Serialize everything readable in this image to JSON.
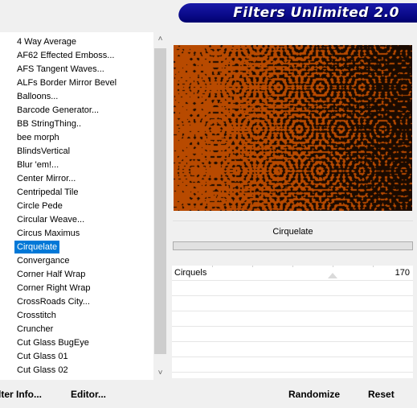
{
  "header": {
    "title": "Filters Unlimited 2.0"
  },
  "filter_list": {
    "items": [
      "4 Way Average",
      "AF62 Effected Emboss...",
      "AFS Tangent Waves...",
      "ALFs Border Mirror Bevel",
      "Balloons...",
      "Barcode Generator...",
      "BB StringThing..",
      "bee morph",
      "BlindsVertical",
      "Blur 'em!...",
      "Center Mirror...",
      "Centripedal Tile",
      "Circle Pede",
      "Circular Weave...",
      "Circus Maximus",
      "Cirquelate",
      "Convergance",
      "Corner Half Wrap",
      "Corner Right Wrap",
      "CrossRoads City...",
      "Crosstitch",
      "Cruncher",
      "Cut Glass  BugEye",
      "Cut Glass 01",
      "Cut Glass 02"
    ],
    "selected": "Cirquelate"
  },
  "scrollbar": {
    "up_glyph": "˄",
    "down_glyph": "˅"
  },
  "preview": {
    "base_color": "#b84a00",
    "dot_color": "#1a0a00"
  },
  "filter_panel": {
    "name": "Cirquelate"
  },
  "parameters": [
    {
      "label": "Cirquels",
      "value": "170"
    }
  ],
  "buttons": {
    "filter_info": "lter Info...",
    "editor": "Editor...",
    "randomize": "Randomize",
    "reset": "Reset"
  }
}
